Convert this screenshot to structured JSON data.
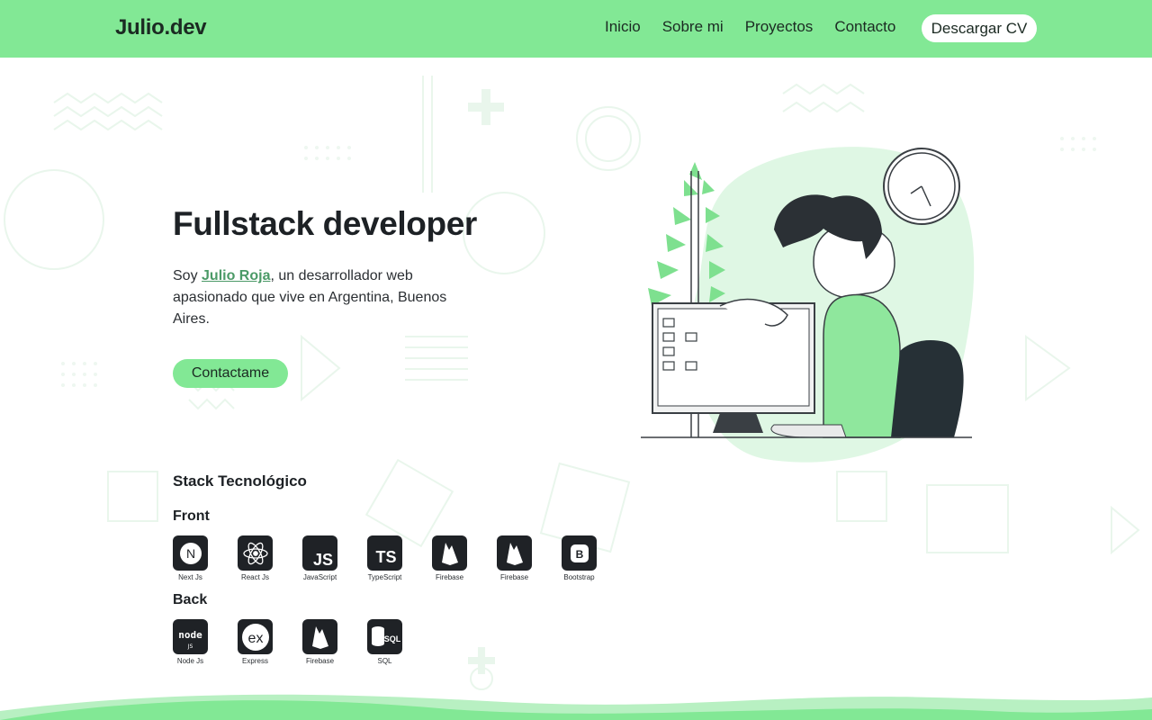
{
  "header": {
    "logo": "Julio.dev",
    "nav": [
      "Inicio",
      "Sobre mi",
      "Proyectos",
      "Contacto"
    ],
    "cv_button": "Descargar CV",
    "bg_color": "#82e895"
  },
  "hero": {
    "title": "Fullstack developer",
    "desc_prefix": "Soy ",
    "name_link": "Julio Roja",
    "desc_suffix": ", un desarrollador web apasionado que vive en Argentina, Buenos Aires.",
    "contact_button": "Contactame"
  },
  "stack": {
    "title": "Stack Tecnológico",
    "front_label": "Front",
    "back_label": "Back",
    "front": [
      {
        "name": "Next Js",
        "icon": "nextjs-icon"
      },
      {
        "name": "React Js",
        "icon": "react-icon"
      },
      {
        "name": "JavaScript",
        "icon": "javascript-icon"
      },
      {
        "name": "TypeScript",
        "icon": "typescript-icon"
      },
      {
        "name": "Firebase",
        "icon": "firebase-icon"
      },
      {
        "name": "Firebase",
        "icon": "firebase-icon"
      },
      {
        "name": "Bootstrap",
        "icon": "bootstrap-icon"
      }
    ],
    "back": [
      {
        "name": "Node Js",
        "icon": "nodejs-icon"
      },
      {
        "name": "Express",
        "icon": "express-icon"
      },
      {
        "name": "Firebase",
        "icon": "firebase-icon"
      },
      {
        "name": "SQL",
        "icon": "sql-icon"
      }
    ]
  },
  "colors": {
    "accent": "#82e895",
    "link": "#4b9a67",
    "dark": "#1f2226"
  }
}
